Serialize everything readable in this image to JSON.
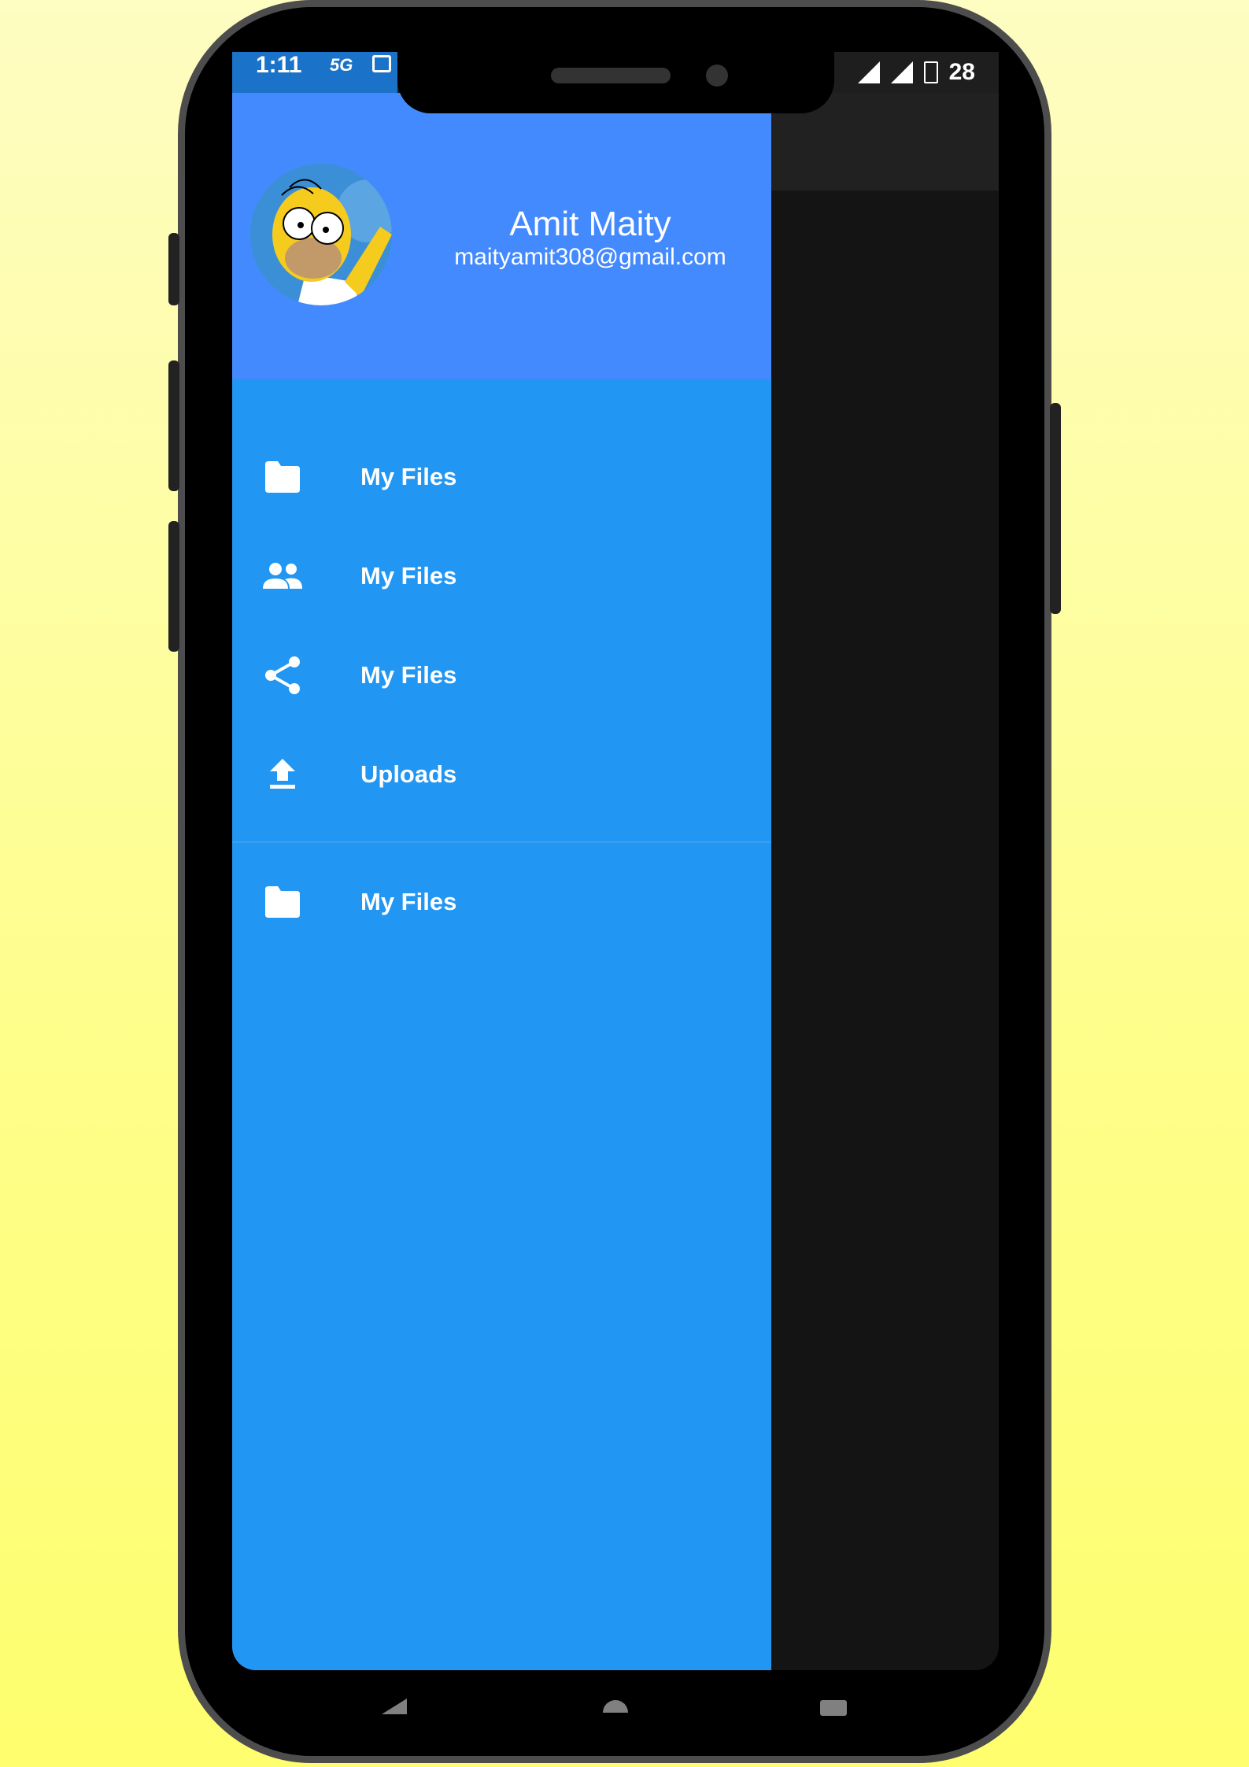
{
  "status_bar": {
    "time": "1:11",
    "network": "5G",
    "battery": "28"
  },
  "drawer": {
    "header": {
      "name": "Amit Maity",
      "email": "maityamit308@gmail.com"
    },
    "items": [
      {
        "icon": "folder-icon",
        "label": "My Files"
      },
      {
        "icon": "people-icon",
        "label": "My Files"
      },
      {
        "icon": "share-icon",
        "label": "My Files"
      },
      {
        "icon": "upload-icon",
        "label": "Uploads"
      }
    ],
    "secondary_items": [
      {
        "icon": "folder-icon",
        "label": "My Files"
      }
    ]
  },
  "colors": {
    "drawer_bg": "#2196f3",
    "header_bg": "#448aff",
    "status_left": "#1a73c8",
    "appbar": "#212121",
    "content_bg": "#141414"
  }
}
